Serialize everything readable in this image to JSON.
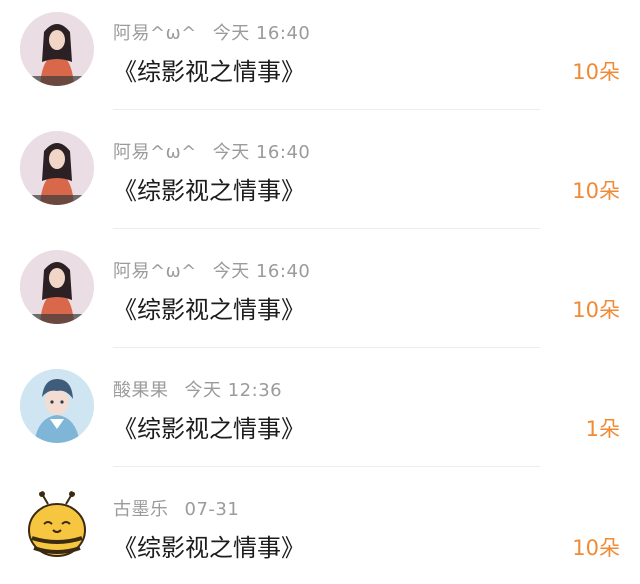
{
  "gifts": [
    {
      "user": "阿易^ω^",
      "time": "今天 16:40",
      "gift": "《综影视之情事》",
      "count": "10朵",
      "avatar": "girl-portrait"
    },
    {
      "user": "阿易^ω^",
      "time": "今天 16:40",
      "gift": "《综影视之情事》",
      "count": "10朵",
      "avatar": "girl-portrait"
    },
    {
      "user": "阿易^ω^",
      "time": "今天 16:40",
      "gift": "《综影视之情事》",
      "count": "10朵",
      "avatar": "girl-portrait"
    },
    {
      "user": "酸果果",
      "time": "今天 12:36",
      "gift": "《综影视之情事》",
      "count": "1朵",
      "avatar": "anime-boy-portrait"
    },
    {
      "user": "古墨乐",
      "time": "07-31",
      "gift": "《综影视之情事》",
      "count": "10朵",
      "avatar": "cartoon-bee"
    }
  ],
  "colors": {
    "count": "#f08a35",
    "meta": "#9b9b9b",
    "text": "#1c1c1c",
    "divider": "#ececec"
  }
}
